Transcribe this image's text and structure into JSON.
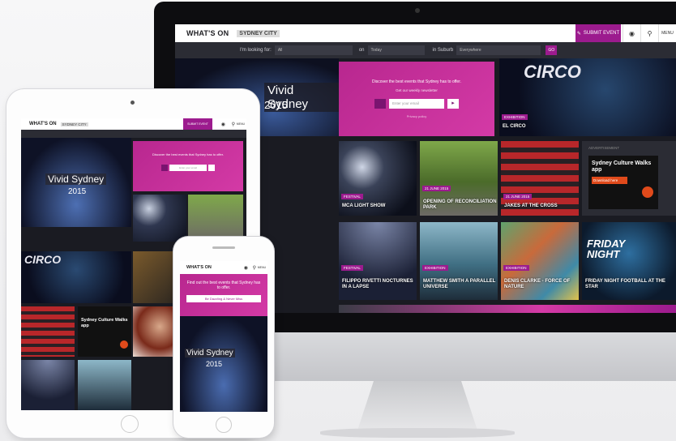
{
  "site": {
    "logo": "WHAT'S ON",
    "logo_x": "X",
    "partner": "SYDNEY CITY",
    "submit_label": "SUBMIT EVENT",
    "menu_label": "MENU"
  },
  "search": {
    "looking_for": "I'm looking for:",
    "all": "All",
    "on": "on",
    "date": "Today",
    "in_suburb": "in Suburb",
    "suburb": "Everywhere",
    "go": "GO"
  },
  "promo": {
    "headline": "Discover the best events that Sydney has to offer.",
    "sub": "Get our weekly newsletter",
    "email_placeholder": "Enter your email",
    "link": "Privacy policy"
  },
  "tiles": [
    {
      "tag": "EXHIBITION",
      "caption": "EL CIRCO"
    },
    {
      "tag": "FESTIVAL",
      "caption": "MCA LIGHT SHOW"
    },
    {
      "tag": "21 JUNE 2015",
      "caption": "OPENING OF RECONCILIATION PARK"
    },
    {
      "tag": "21 JUNE 2015",
      "caption": "JAKES AT THE CROSS"
    },
    {
      "tag": "FESTIVAL",
      "caption": "FILIPPO RIVETTI NOCTURNES IN A LAPSE"
    },
    {
      "tag": "EXHIBITION",
      "caption": "MATTHEW SMITH A PARALLEL UNIVERSE"
    },
    {
      "tag": "EXHIBITION",
      "caption": "DENIS CLARKE - FORCE OF NATURE"
    },
    {
      "tag": "",
      "caption": "FRIDAY NIGHT FOOTBALL AT THE STAR"
    }
  ],
  "hero": {
    "title": "Vivid Sydney",
    "year": "2015"
  },
  "app": {
    "section": "ADVERTISEMENT",
    "title": "Sydney Culture Walks app",
    "cta": "Download here"
  },
  "friday": {
    "line1": "FRIDAY",
    "line2": "NIGHT"
  },
  "circo": "CIRCO",
  "phone": {
    "headline": "Find out the best events that Sydney has to offer.",
    "cta": "Be Dazzling & Never Miss",
    "hero_title": "Vivid Sydney",
    "hero_year": "2015"
  },
  "colors": {
    "accent": "#9c1b8e",
    "magenta": "#d43aa6",
    "bg": "#1a1b22"
  }
}
